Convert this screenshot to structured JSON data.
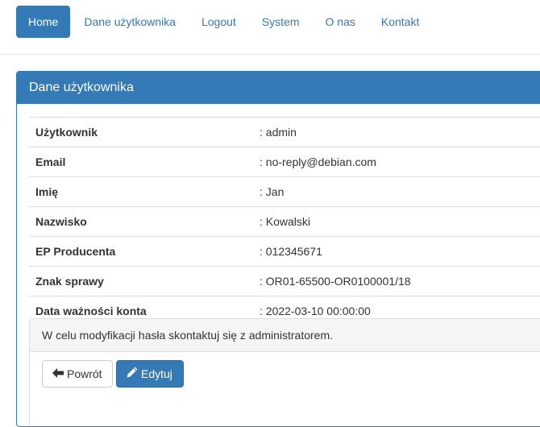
{
  "nav": {
    "items": [
      {
        "label": "Home",
        "active": true
      },
      {
        "label": "Dane użytkownika",
        "active": false
      },
      {
        "label": "Logout",
        "active": false
      },
      {
        "label": "System",
        "active": false
      },
      {
        "label": "O nas",
        "active": false
      },
      {
        "label": "Kontakt",
        "active": false
      }
    ]
  },
  "panel": {
    "title": "Dane użytkownika",
    "rows": [
      {
        "key": "Użytkownik",
        "value": ": admin"
      },
      {
        "key": "Email",
        "value": ": no-reply@debian.com"
      },
      {
        "key": "Imię",
        "value": ": Jan"
      },
      {
        "key": "Nazwisko",
        "value": ": Kowalski"
      },
      {
        "key": "EP Producenta",
        "value": ": 012345671"
      },
      {
        "key": "Znak sprawy",
        "value": ": OR01-65500-OR0100001/18"
      },
      {
        "key": "Data ważności konta",
        "value": ": 2022-03-10 00:00:00"
      }
    ]
  },
  "notice": {
    "text": "W celu modyfikacji hasła skontaktuj się z administratorem."
  },
  "buttons": {
    "back_label": "Powrót",
    "back_icon": "arrow-left-icon",
    "edit_label": "Edytuj",
    "edit_icon": "pencil-icon"
  },
  "colors": {
    "primary": "#337ab7",
    "border": "#dddddd"
  }
}
